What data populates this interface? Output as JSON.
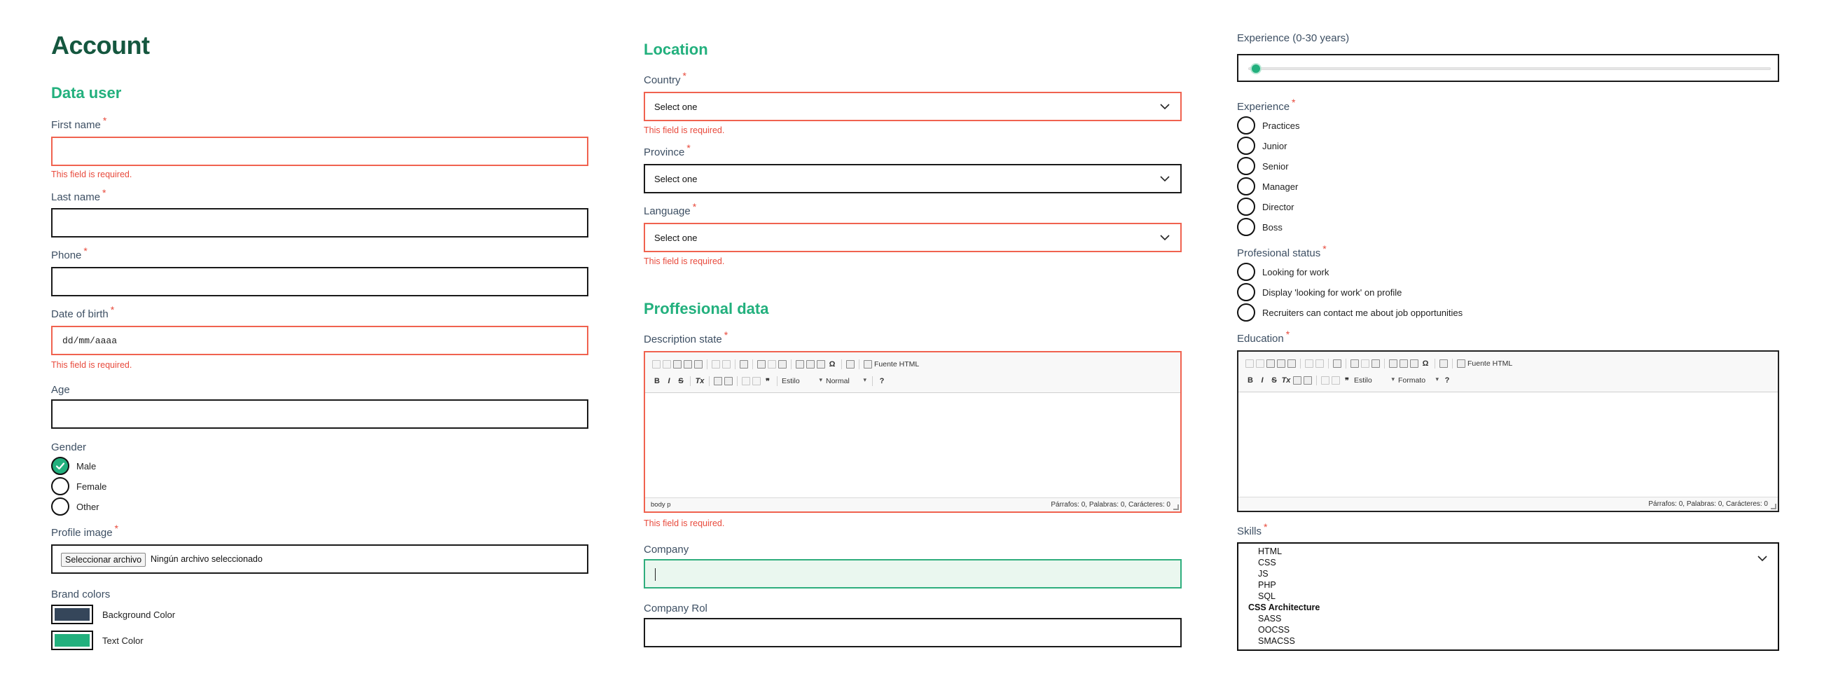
{
  "account": {
    "title": "Account",
    "data_user_heading": "Data user",
    "first_name": {
      "label": "First name",
      "required": "*",
      "error": "This field is required."
    },
    "last_name": {
      "label": "Last name",
      "required": "*"
    },
    "phone": {
      "label": "Phone",
      "required": "*"
    },
    "dob": {
      "label": "Date of birth",
      "required": "*",
      "value": "dd/mm/aaaa",
      "error": "This field is required."
    },
    "age": {
      "label": "Age"
    },
    "gender": {
      "label": "Gender",
      "options": [
        "Male",
        "Female",
        "Other"
      ],
      "selected": "Male"
    },
    "profile_image": {
      "label": "Profile image",
      "required": "*",
      "button": "Seleccionar archivo",
      "status": "Ningún archivo seleccionado"
    },
    "brand_colors": {
      "label": "Brand colors",
      "items": [
        {
          "label": "Background Color",
          "color": "#35465a"
        },
        {
          "label": "Text Color",
          "color": "#22b07d"
        }
      ]
    }
  },
  "location": {
    "heading": "Location",
    "country": {
      "label": "Country",
      "required": "*",
      "value": "Select one",
      "error": "This field is required."
    },
    "province": {
      "label": "Province",
      "required": "*",
      "value": "Select one"
    },
    "language": {
      "label": "Language",
      "required": "*",
      "value": "Select one",
      "error": "This field is required."
    }
  },
  "professional": {
    "heading": "Proffesional data",
    "description": {
      "label": "Description state",
      "required": "*",
      "error": "This field is required.",
      "toolbar": {
        "source": "Fuente HTML",
        "style": "Estilo",
        "format": "Normal"
      },
      "path": "body  p",
      "count": "Párrafos: 0, Palabras: 0, Carácteres: 0"
    },
    "company": {
      "label": "Company"
    },
    "company_rol": {
      "label": "Company Rol"
    }
  },
  "experience": {
    "range_label": "Experience (0-30 years)",
    "range_value": 0,
    "level": {
      "label": "Experience",
      "required": "*",
      "options": [
        "Practices",
        "Junior",
        "Senior",
        "Manager",
        "Director",
        "Boss"
      ]
    },
    "status": {
      "label": "Profesional status",
      "required": "*",
      "options": [
        "Looking for work",
        "Display 'looking for work' on profile",
        "Recruiters can contact me about job opportunities"
      ]
    },
    "education": {
      "label": "Education",
      "required": "*",
      "toolbar": {
        "source": "Fuente HTML",
        "style": "Estilo",
        "format": "Formato"
      },
      "count": "Párrafos: 0, Palabras: 0, Carácteres: 0"
    },
    "skills": {
      "label": "Skills",
      "required": "*",
      "items": [
        "HTML",
        "CSS",
        "JS",
        "PHP",
        "SQL"
      ],
      "group": "CSS Architecture",
      "group_items": [
        "SASS",
        "OOCSS",
        "SMACSS"
      ]
    }
  },
  "colors": {
    "accent": "#22b07d",
    "title": "#15573f",
    "error": "#e84a3c"
  }
}
